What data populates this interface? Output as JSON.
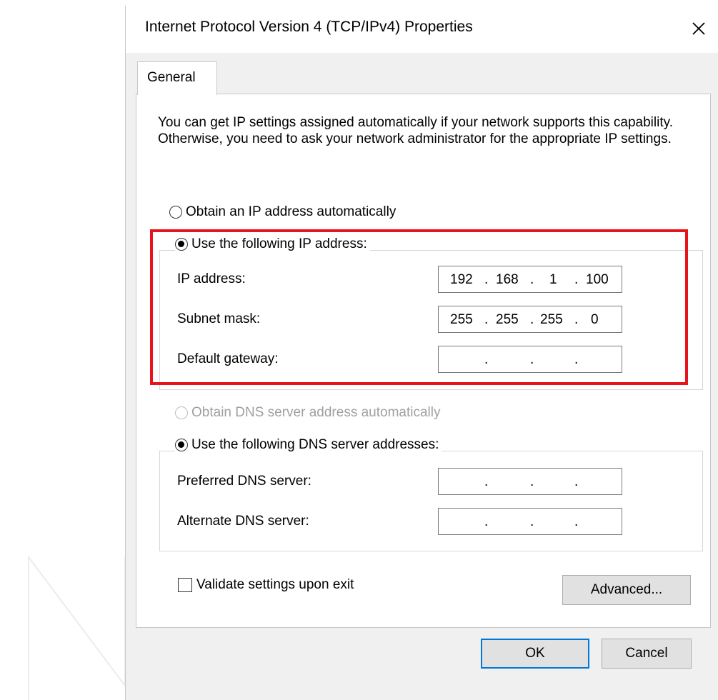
{
  "window": {
    "title": "Internet Protocol Version 4 (TCP/IPv4) Properties",
    "close_icon": "close-icon"
  },
  "tabs": [
    {
      "label": "General",
      "selected": true
    }
  ],
  "description": "You can get IP settings assigned automatically if your network supports this capability. Otherwise, you need to ask your network administrator for the appropriate IP settings.",
  "ip": {
    "auto_label": "Obtain an IP address automatically",
    "auto_selected": false,
    "manual_label": "Use the following IP address:",
    "manual_selected": true,
    "fields": [
      {
        "label": "IP address:",
        "octets": [
          "192",
          "168",
          "1",
          "100"
        ]
      },
      {
        "label": "Subnet mask:",
        "octets": [
          "255",
          "255",
          "255",
          "0"
        ]
      },
      {
        "label": "Default gateway:",
        "octets": [
          "",
          "",
          "",
          ""
        ]
      }
    ]
  },
  "dns": {
    "auto_label": "Obtain DNS server address automatically",
    "auto_selected": false,
    "auto_disabled": true,
    "manual_label": "Use the following DNS server addresses:",
    "manual_selected": true,
    "fields": [
      {
        "label": "Preferred DNS server:",
        "octets": [
          "",
          "",
          "",
          ""
        ]
      },
      {
        "label": "Alternate DNS server:",
        "octets": [
          "",
          "",
          "",
          ""
        ]
      }
    ]
  },
  "validate": {
    "label": "Validate settings upon exit",
    "checked": false
  },
  "buttons": {
    "advanced": "Advanced...",
    "ok": "OK",
    "cancel": "Cancel"
  },
  "colors": {
    "highlight": "#e8141b",
    "default_button_border": "#0078d7",
    "dialog_bg": "#f0f0f0"
  }
}
